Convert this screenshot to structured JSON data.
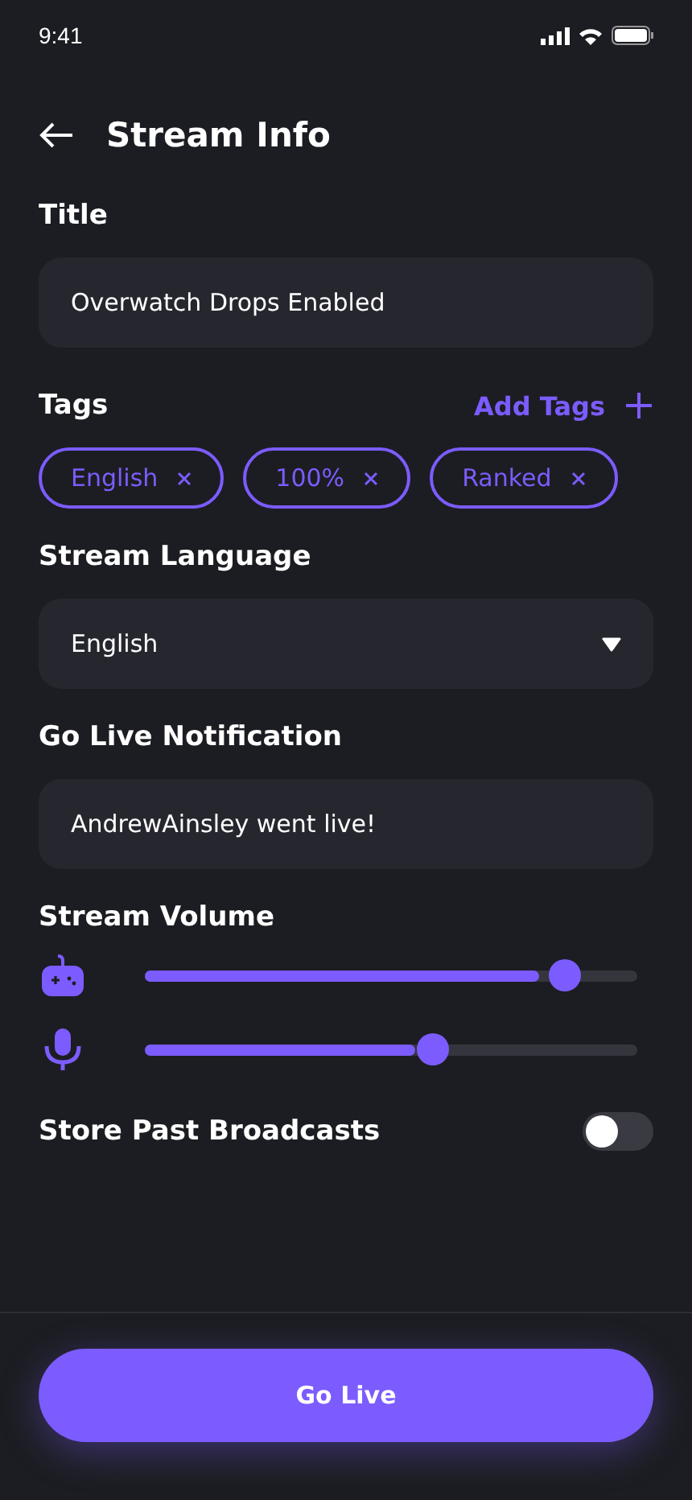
{
  "status_bar": {
    "time": "9:41"
  },
  "header": {
    "title": "Stream Info"
  },
  "title_field": {
    "label": "Title",
    "value": "Overwatch Drops Enabled"
  },
  "tags": {
    "label": "Tags",
    "add_label": "Add Tags",
    "items": [
      {
        "label": "English"
      },
      {
        "label": "100%"
      },
      {
        "label": "Ranked"
      }
    ]
  },
  "language": {
    "label": "Stream Language",
    "value": "English"
  },
  "notification": {
    "label": "Go Live Notification",
    "value": "AndrewAinsley went live!"
  },
  "volume": {
    "label": "Stream Volume",
    "sliders": [
      {
        "kind": "game",
        "level": 0.8
      },
      {
        "kind": "mic",
        "level": 0.55
      }
    ]
  },
  "store_broadcasts": {
    "label": "Store Past Broadcasts",
    "on": false
  },
  "go_live_button": {
    "label": "Go Live"
  }
}
